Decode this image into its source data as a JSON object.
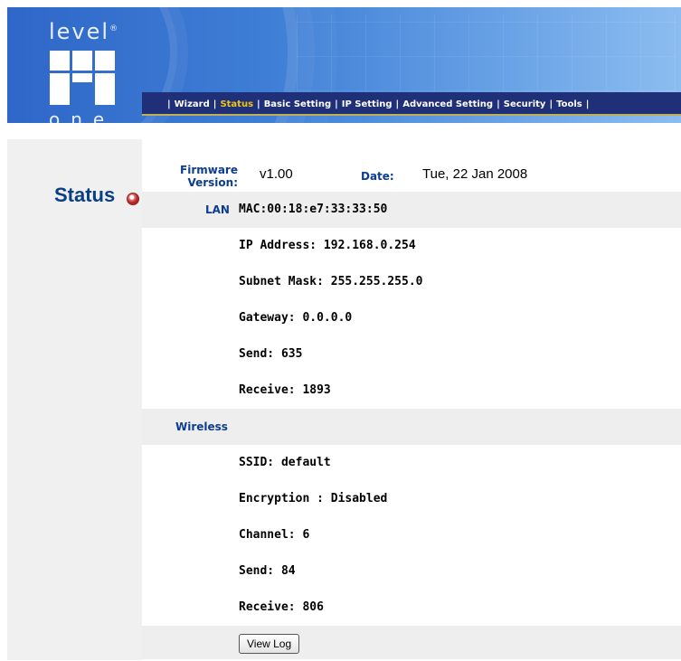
{
  "brand": {
    "logo_top": "level",
    "logo_reg": "®",
    "logo_bottom": "one"
  },
  "nav": {
    "items": [
      {
        "label": "Wizard"
      },
      {
        "label": "Status",
        "active": true
      },
      {
        "label": "Basic Setting"
      },
      {
        "label": "IP Setting"
      },
      {
        "label": "Advanced Setting"
      },
      {
        "label": "Security"
      },
      {
        "label": "Tools"
      }
    ],
    "separator": "|"
  },
  "sidebar": {
    "title": "Status",
    "icon": "status-bullet-icon"
  },
  "firmware": {
    "label_line1": "Firmware",
    "label_line2": "Version:",
    "value": "v1.00"
  },
  "date": {
    "label": "Date:",
    "value": "Tue, 22 Jan 2008"
  },
  "lan": {
    "label": "LAN",
    "mac": "MAC:00:18:e7:33:33:50",
    "ip": "IP Address: 192.168.0.254",
    "subnet": "Subnet Mask: 255.255.255.0",
    "gateway": "Gateway: 0.0.0.0",
    "send": "Send: 635",
    "receive": "Receive: 1893"
  },
  "wireless": {
    "label": "Wireless",
    "ssid": "SSID: default",
    "encryption": "Encryption : Disabled",
    "channel": "Channel: 6",
    "send": "Send: 84",
    "receive": "Receive: 806"
  },
  "buttons": {
    "view_log": "View Log"
  },
  "colors": {
    "header_blue": "#2a63c7",
    "nav_bg": "#1f2f78",
    "nav_active": "#f0c419",
    "label_blue": "#0c3d8f",
    "shade": "#eeeeee"
  }
}
